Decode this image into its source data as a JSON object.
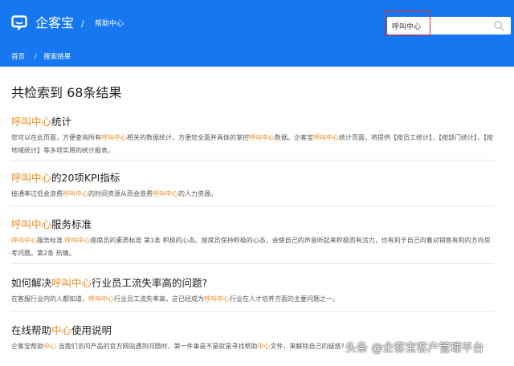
{
  "header": {
    "brand": "企客宝",
    "separator": "/",
    "section": "帮助中心"
  },
  "search": {
    "value": "呼叫中心"
  },
  "breadcrumb": {
    "home": "首页",
    "separator": "/",
    "current": "搜索结果"
  },
  "results_heading": "共检索到 68条结果",
  "results": [
    {
      "title": [
        {
          "t": "呼叫中心",
          "hl": true
        },
        {
          "t": "统计",
          "hl": false
        }
      ],
      "desc": [
        {
          "t": "您可以在此页面，方便查询所有",
          "hl": false
        },
        {
          "t": "呼叫中心",
          "hl": true
        },
        {
          "t": "相关的数据统计，方便您全面并具体的掌控",
          "hl": false
        },
        {
          "t": "呼叫中心",
          "hl": true
        },
        {
          "t": "数据。企客宝",
          "hl": false
        },
        {
          "t": "呼叫中心",
          "hl": true
        },
        {
          "t": "统计页面，将提供【按员工统计】，【按部门统计】，【按地域统计】等多项实用的统计报表。",
          "hl": false
        }
      ]
    },
    {
      "title": [
        {
          "t": "呼叫中心",
          "hl": true
        },
        {
          "t": "的20项KPI指标",
          "hl": false
        }
      ],
      "desc": [
        {
          "t": "接通率过低会浪费",
          "hl": false
        },
        {
          "t": "呼叫中心",
          "hl": true
        },
        {
          "t": "的时间资源从而会浪费",
          "hl": false
        },
        {
          "t": "呼叫中心",
          "hl": true
        },
        {
          "t": "的人力资源。",
          "hl": false
        }
      ]
    },
    {
      "title": [
        {
          "t": "呼叫中心",
          "hl": true
        },
        {
          "t": "服务标准",
          "hl": false
        }
      ],
      "desc": [
        {
          "t": "呼叫中心",
          "hl": true
        },
        {
          "t": "服务标准 ",
          "hl": false
        },
        {
          "t": "呼叫中心",
          "hl": true
        },
        {
          "t": "座席员的素质标准 第1条 积极的心态。座席员保持积极的心态，会使自己的声音听起来积极而有活力，也有利于自己向着对销售有利的方向思考问题。第2条 热情。",
          "hl": false
        }
      ]
    },
    {
      "title": [
        {
          "t": "如何解决",
          "hl": false
        },
        {
          "t": "呼叫中心",
          "hl": true
        },
        {
          "t": "行业员工流失率高的问题?",
          "hl": false
        }
      ],
      "desc": [
        {
          "t": "在客服行业内的人都知道，",
          "hl": false
        },
        {
          "t": "呼叫中心",
          "hl": true
        },
        {
          "t": "行业员工流失率高，这已经成为",
          "hl": false
        },
        {
          "t": "呼叫中心",
          "hl": true
        },
        {
          "t": "行业在人才培养方面的主要问题之一。",
          "hl": false
        }
      ]
    },
    {
      "title": [
        {
          "t": "在线帮助",
          "hl": false
        },
        {
          "t": "中心",
          "hl": true
        },
        {
          "t": "使用说明",
          "hl": false
        }
      ],
      "desc": [
        {
          "t": "企客宝帮助",
          "hl": false
        },
        {
          "t": "中心",
          "hl": true
        },
        {
          "t": " 当我们访问产品的官方网站遇到问题时，第一件事是不是就是寻找帮助",
          "hl": false
        },
        {
          "t": "中心",
          "hl": true
        },
        {
          "t": "文件，来解除自己的疑惑?",
          "hl": false
        }
      ]
    }
  ],
  "watermark": "头条 @企客宝客户管理平台",
  "colors": {
    "header_bg": "#1677f0",
    "keyword_highlight": "#f08a1c",
    "search_outline": "#e0282e"
  }
}
